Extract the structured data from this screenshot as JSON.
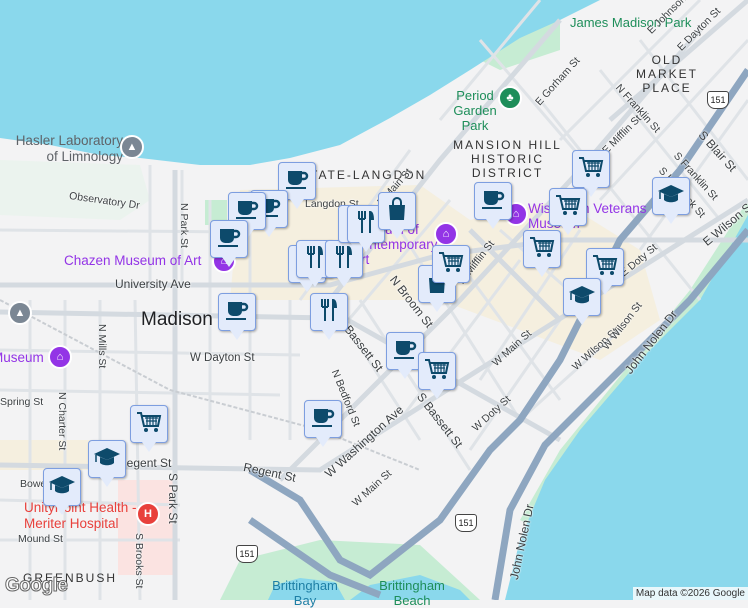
{
  "colors": {
    "water": "#8ad8ec",
    "land": "#f3f3f4",
    "park": "#c6ecd3",
    "highway": "#8ea6c0",
    "road": "#d4dae0",
    "commercial": "#f5ecd6",
    "marker_bg": "#e3ebfb",
    "marker_icon": "#0d4a6b"
  },
  "labels": {
    "james_madison_park": "James Madison Park",
    "old_market_place": "OLD MARKET PLACE",
    "period_garden_park": "Period Garden Park",
    "mansion_hill": "MANSION HILL HISTORIC DISTRICT",
    "hasler_lab": "Hasler Laboratory of Limnology",
    "state_langdon": "STATE-LANGDON",
    "chazen": "Chazen Museum of Art",
    "contemporary_art": "Museum of Contemporary Art",
    "veterans_museum": "Wisconsin Veterans Museum",
    "museum_left": "Museum",
    "madison": "Madison",
    "meriter": "UnityPoint Health - Meriter Hospital",
    "greenbush": "GREENBUSH",
    "brittingham_bay": "Brittingham Bay",
    "brittingham_beach": "Brittingham Beach"
  },
  "streets": {
    "e_johnson": "E Johnson St",
    "e_dayton": "E Dayton St",
    "e_gorham": "E Gorham St",
    "n_franklin": "N Franklin St",
    "mifflin": "E Mifflin St",
    "s_blair": "S Blair St",
    "e_main": "E Main St",
    "s_franklin": "S Franklin St",
    "s_hancock": "S Hancock St",
    "e_wilson": "E Wilson St",
    "e_doty": "E Doty St",
    "observatory": "Observatory Dr",
    "n_park": "N Park St",
    "langdon": "Langdon St",
    "university": "University Ave",
    "n_broom": "N Broom St",
    "w_mifflin": "W Mifflin St",
    "n_bassett": "N Bassett St",
    "w_dayton": "W Dayton St",
    "n_mills": "N Mills St",
    "spring": "Spring St",
    "n_charter": "N Charter St",
    "n_bedford": "N Bedford St",
    "w_washington": "W Washington Ave",
    "s_bassett": "S Bassett St",
    "w_main": "W Main St",
    "w_wilson": "W Wilson St",
    "w_doty": "W Doty St",
    "w_main2": "W Main St",
    "john_nolen": "John Nolen Dr",
    "john_nolen2": "John Nolen Dr",
    "regent": "Regent St",
    "regent2": "Regent St",
    "s_park": "S Park St",
    "s_brooks": "S Brooks St",
    "bowen": "Bowen Ct",
    "mound": "Mound St",
    "w_wilson2": "W Wilson St"
  },
  "highway_shield": "151",
  "markers": [
    {
      "type": "coffee"
    },
    {
      "type": "coffee"
    },
    {
      "type": "coffee"
    },
    {
      "type": "coffee"
    },
    {
      "type": "coffee"
    },
    {
      "type": "coffee"
    },
    {
      "type": "coffee"
    },
    {
      "type": "coffee"
    },
    {
      "type": "restaurant"
    },
    {
      "type": "restaurant"
    },
    {
      "type": "restaurant"
    },
    {
      "type": "restaurant"
    },
    {
      "type": "restaurant"
    },
    {
      "type": "restaurant"
    },
    {
      "type": "shopping-bag"
    },
    {
      "type": "shopping-bag"
    },
    {
      "type": "cart"
    },
    {
      "type": "cart"
    },
    {
      "type": "cart"
    },
    {
      "type": "cart"
    },
    {
      "type": "cart"
    },
    {
      "type": "cart"
    },
    {
      "type": "cart"
    },
    {
      "type": "graduation-cap"
    },
    {
      "type": "graduation-cap"
    },
    {
      "type": "graduation-cap"
    },
    {
      "type": "graduation-cap"
    }
  ],
  "attribution": "Map data ©2026 Google",
  "logo": "Google"
}
